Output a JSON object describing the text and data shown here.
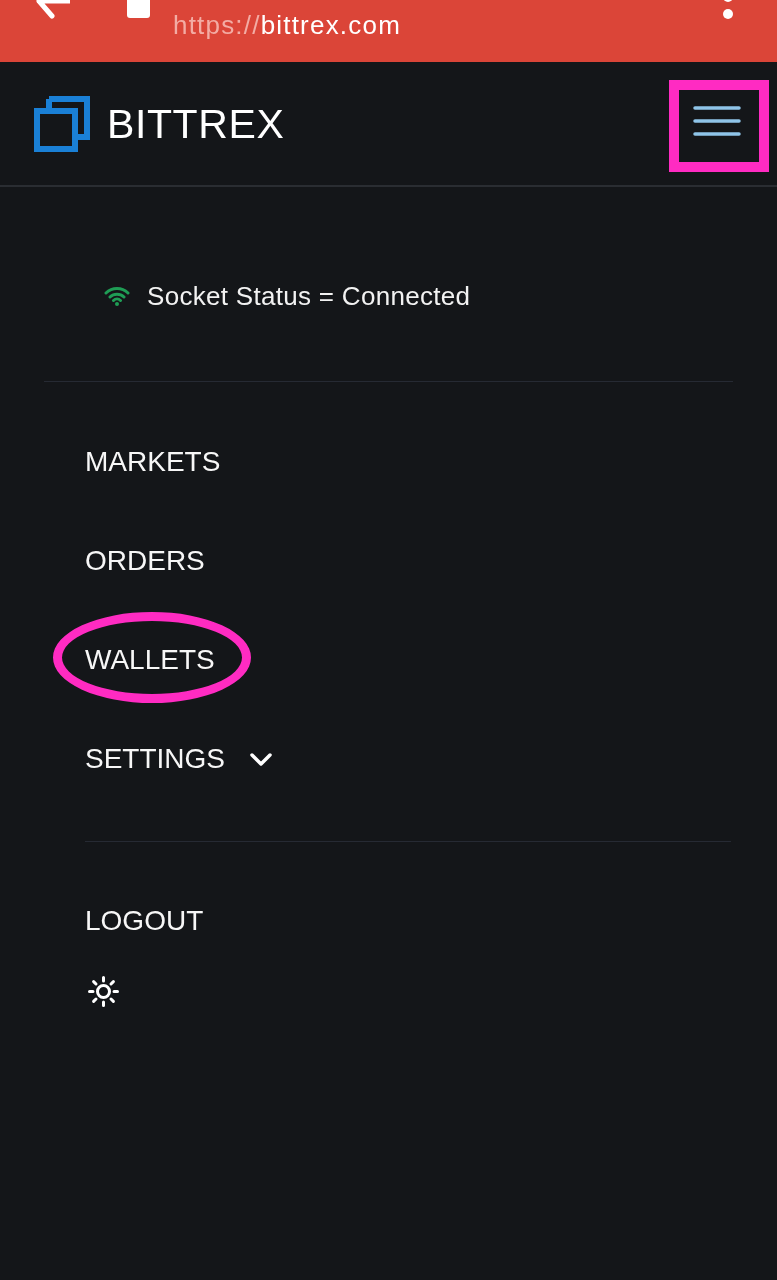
{
  "browser_bar": {
    "url": {
      "scheme": "https://",
      "host": "bittrex.com"
    }
  },
  "header": {
    "logo_text": "BITTREX",
    "menu_button": {
      "highlighted": true
    }
  },
  "socket_status": {
    "label": "Socket Status = Connected",
    "connected": true
  },
  "nav": [
    {
      "kind": "link",
      "label": "MARKETS",
      "highlighted": false
    },
    {
      "kind": "link",
      "label": "ORDERS",
      "highlighted": false
    },
    {
      "kind": "link",
      "label": "WALLETS",
      "highlighted": true
    },
    {
      "kind": "dropdown",
      "label": "SETTINGS",
      "highlighted": false,
      "expanded": false
    }
  ],
  "logout": {
    "label": "LOGOUT"
  }
}
